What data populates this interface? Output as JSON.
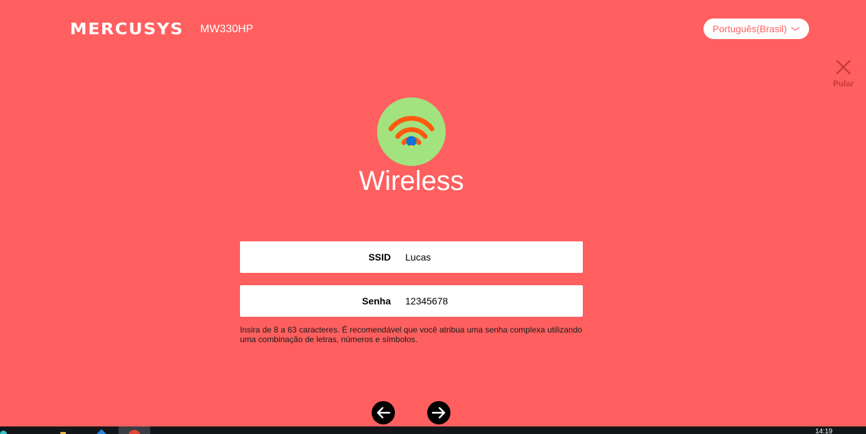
{
  "header": {
    "brand": "MERCUSYS",
    "model": "MW330HP",
    "language": "Português(Brasil)",
    "language_chevron_icon": "chevron-down-icon"
  },
  "skip": {
    "icon": "close-icon",
    "label": "Pular",
    "color": "#c8393c"
  },
  "wizard": {
    "step_icon": "wifi-icon",
    "title": "Wireless",
    "ssid_label": "SSID",
    "ssid_value": "Lucas",
    "password_label": "Senha",
    "password_value": "12345678",
    "hint": "Insira de 8 a 63 caracteres. É recomendável que você atribua uma senha complexa utilizando uma combinação de letras, números e símbolos."
  },
  "navigation": {
    "prev_icon": "arrow-left-icon",
    "next_icon": "arrow-right-icon"
  },
  "taskbar": {
    "clock": "14:19"
  },
  "colors": {
    "background": "#ff5f5f",
    "icon_circle": "#a2e27f",
    "wifi_arcs": "#ff5a0e",
    "wifi_dot": "#0f72d8",
    "text_on_bg": "#ffffff"
  }
}
